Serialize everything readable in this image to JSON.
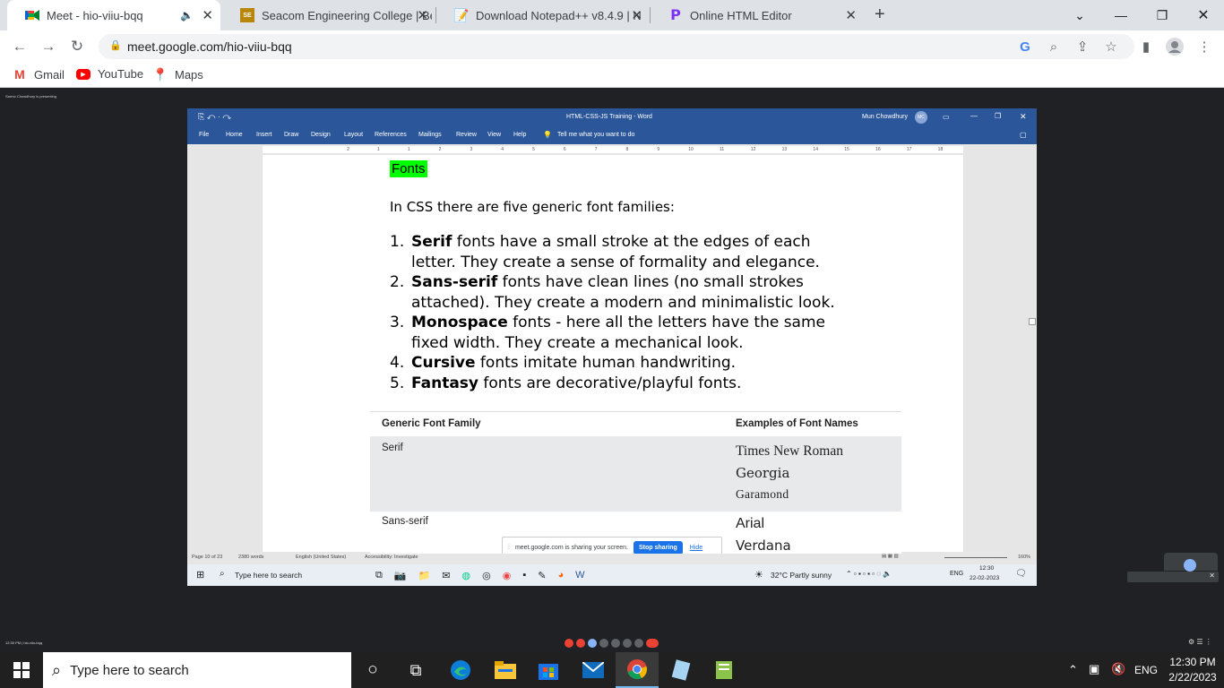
{
  "browser": {
    "tabs": [
      {
        "title": "Meet - hio-viiu-bqq",
        "favicon": "meet-icon",
        "active": true
      },
      {
        "title": "Seacom Engineering College | Be",
        "favicon": "seacom-icon",
        "active": false
      },
      {
        "title": "Download Notepad++ v8.4.9 | N",
        "favicon": "notepad-icon",
        "active": false
      },
      {
        "title": "Online HTML Editor",
        "favicon": "editor-icon",
        "active": false
      }
    ],
    "new_tab": "+",
    "url": "meet.google.com/hio-viiu-bqq",
    "bookmarks": [
      {
        "label": "Gmail",
        "icon": "gmail-icon"
      },
      {
        "label": "YouTube",
        "icon": "youtube-icon"
      },
      {
        "label": "Maps",
        "icon": "maps-icon"
      }
    ]
  },
  "meet": {
    "presenting": "Sarmo Chowdhury is presenting",
    "meeting_code": "12:30 PM | hio-viiu-bqq"
  },
  "word": {
    "title": "HTML-CSS-JS Training - Word",
    "user": "Mun Chowdhury",
    "user_initials": "MC",
    "ribbon_tabs": [
      "File",
      "Home",
      "Insert",
      "Draw",
      "Design",
      "Layout",
      "References",
      "Mailings",
      "Review",
      "View",
      "Help"
    ],
    "tell_me": "Tell me what you want to do",
    "ruler_marks": [
      "2",
      "1",
      "1",
      "2",
      "3",
      "4",
      "5",
      "6",
      "7",
      "8",
      "9",
      "10",
      "11",
      "12",
      "13",
      "14",
      "15",
      "16",
      "17",
      "18"
    ],
    "status": {
      "page": "Page 10 of 23",
      "words": "2380 words",
      "language": "English (United States)",
      "accessibility": "Accessibility: Investigate",
      "zoom": "160%"
    }
  },
  "document": {
    "heading": "Fonts",
    "intro": "In CSS there are five generic font families:",
    "list": [
      {
        "num": "1.",
        "bold": "Serif",
        "rest": " fonts have a small stroke at the edges of each",
        "cont": "letter. They create a sense of formality and elegance."
      },
      {
        "num": "2.",
        "bold": "Sans-serif",
        "rest": " fonts have clean lines (no small strokes",
        "cont": "attached). They create a modern and minimalistic look."
      },
      {
        "num": "3.",
        "bold": "Monospace",
        "rest": " fonts - here all the letters have the same",
        "cont": "fixed width. They create a mechanical look."
      },
      {
        "num": "4.",
        "bold": "Cursive",
        "rest": " fonts imitate human handwriting.",
        "cont": ""
      },
      {
        "num": "5.",
        "bold": "Fantasy",
        "rest": " fonts are decorative/playful fonts.",
        "cont": ""
      }
    ],
    "table": {
      "headers": [
        "Generic Font Family",
        "Examples of Font Names"
      ],
      "rows": [
        {
          "family": "Serif",
          "examples": [
            "Times New Roman",
            "Georgia",
            "Garamond"
          ]
        },
        {
          "family": "Sans-serif",
          "examples": [
            "Arial",
            "Verdana"
          ]
        }
      ]
    },
    "sharing": {
      "message": "meet.google.com is sharing your screen.",
      "stop": "Stop sharing",
      "hide": "Hide"
    }
  },
  "inner_taskbar": {
    "search": "Type here to search",
    "weather": "32°C  Partly sunny",
    "lang": "ENG",
    "time": "12:30",
    "date": "22-02-2023"
  },
  "taskbar": {
    "search_placeholder": "Type here to search",
    "lang": "ENG",
    "time": "12:30 PM",
    "date": "2/22/2023"
  }
}
